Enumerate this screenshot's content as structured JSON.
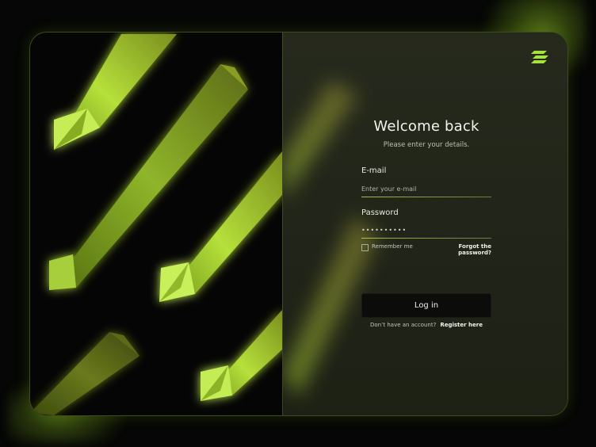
{
  "login": {
    "title": "Welcome back",
    "subtitle": "Please enter your details.",
    "email": {
      "label": "E-mail",
      "placeholder": "Enter your e-mail",
      "value": ""
    },
    "password": {
      "label": "Password",
      "value": "••••••••••"
    },
    "remember_label": "Remember me",
    "remember_checked": false,
    "forgot_label": "Forgot the password?",
    "login_button": "Log in",
    "register_prompt": "Don’t have an account?",
    "register_link": "Register here"
  },
  "brand": {
    "logo_icon": "brand-logo-icon",
    "accent_color": "#a8e23a"
  }
}
